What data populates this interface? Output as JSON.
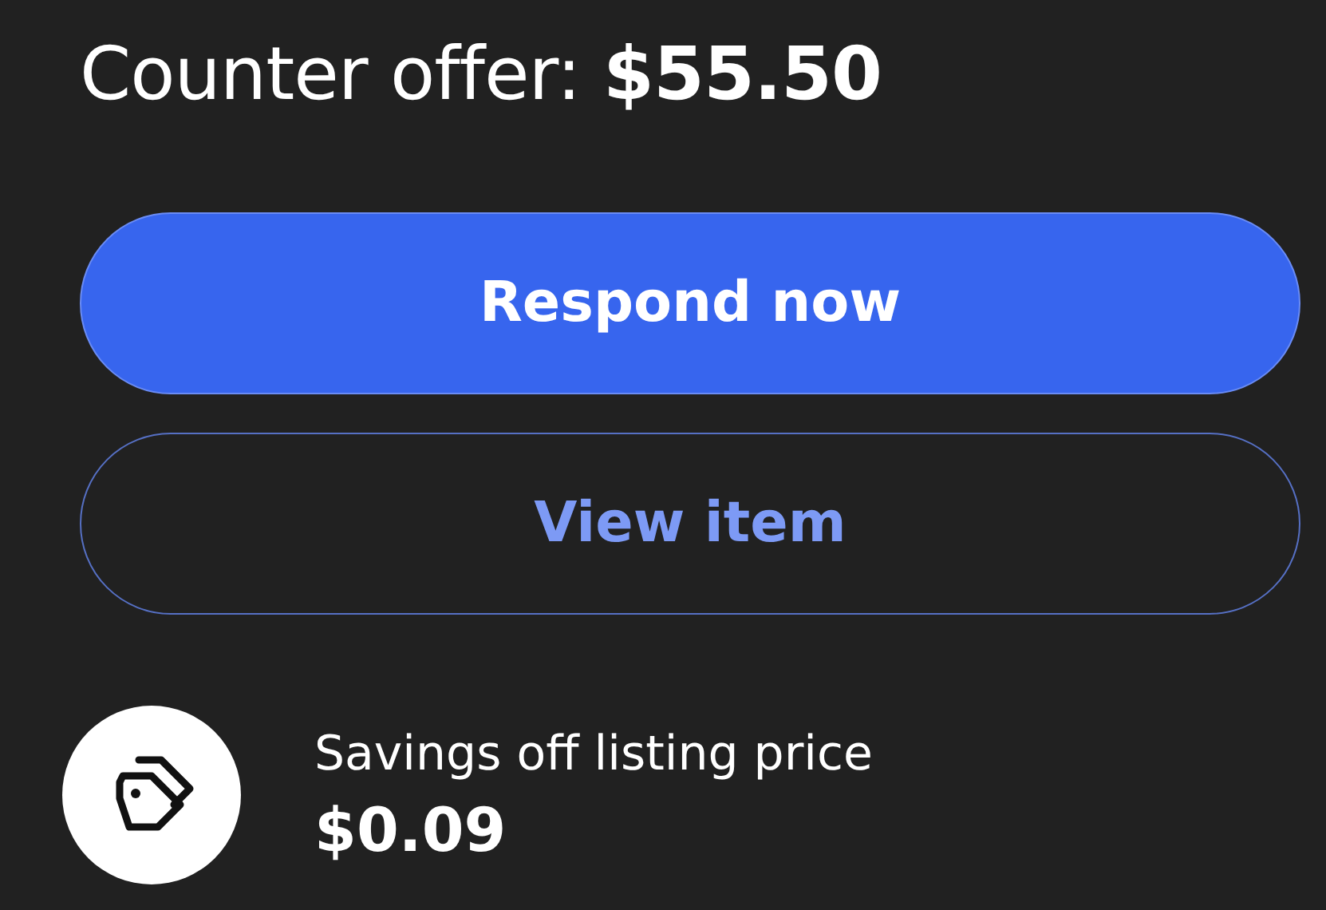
{
  "heading": "Counter offer: **$55.50**",
  "buttons": [
    {
      "label": "Respond now",
      "kind": "primary"
    },
    {
      "label": "View item",
      "kind": "secondary"
    }
  ],
  "savings": {
    "label": "Savings off listing price",
    "value": "$0.09"
  }
}
